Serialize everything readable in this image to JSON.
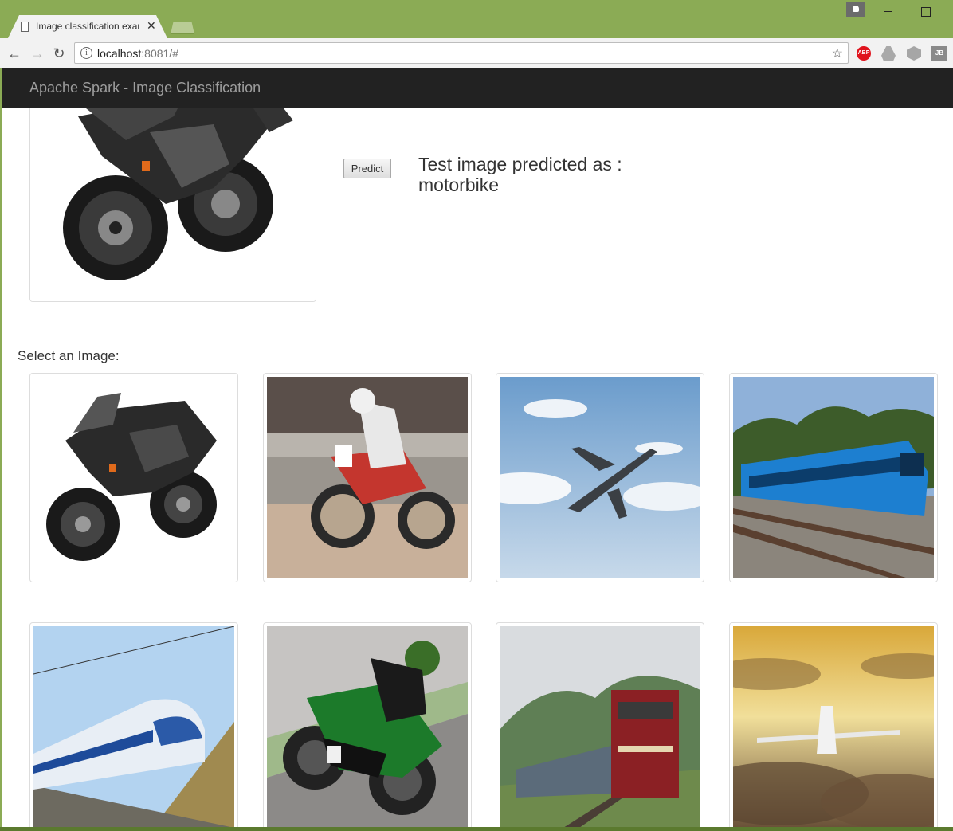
{
  "browser": {
    "tab_title": "Image classification exam",
    "tab_close": "✕",
    "url_host": "localhost",
    "url_rest": ":8081/#",
    "extension_abp": "ABP",
    "extension_jb": "JB"
  },
  "navbar": {
    "brand": "Apache Spark - Image Classification"
  },
  "main": {
    "predict_label": "Predict",
    "result_prefix": "Test image predicted as :",
    "result_value": "motorbike",
    "select_label": "Select an Image:"
  },
  "gallery": [
    {
      "kind": "motorbike",
      "scene": "black sport motorbike on white"
    },
    {
      "kind": "motorbike",
      "scene": "flat track racer"
    },
    {
      "kind": "airplane",
      "scene": "airliner in blue sky"
    },
    {
      "kind": "train",
      "scene": "blue passenger train"
    },
    {
      "kind": "train",
      "scene": "blue high-speed train"
    },
    {
      "kind": "motorbike",
      "scene": "green racing motorbike"
    },
    {
      "kind": "train",
      "scene": "red locomotive in mountains"
    },
    {
      "kind": "airplane",
      "scene": "airliner in golden sky"
    }
  ],
  "colors": {
    "frame": "#8bab55",
    "navbar_bg": "#222222",
    "navbar_text": "#9d9d9d"
  }
}
